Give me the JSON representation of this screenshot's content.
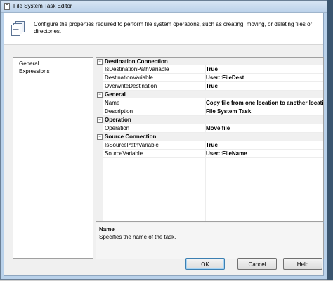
{
  "window": {
    "title": "File System Task Editor"
  },
  "header": {
    "description": "Configure the properties required to perform file system operations, such as creating, moving, or deleting files or directories."
  },
  "nav": {
    "items": [
      "General",
      "Expressions"
    ]
  },
  "grid": {
    "categories": [
      {
        "name": "Destination Connection",
        "rows": [
          {
            "key": "IsDestinationPathVariable",
            "value": "True"
          },
          {
            "key": "DestinationVariable",
            "value": "User::FileDest"
          },
          {
            "key": "OverwriteDestination",
            "value": "True"
          }
        ]
      },
      {
        "name": "General",
        "rows": [
          {
            "key": "Name",
            "value": "Copy file from one location to another location"
          },
          {
            "key": "Description",
            "value": "File System Task"
          }
        ]
      },
      {
        "name": "Operation",
        "rows": [
          {
            "key": "Operation",
            "value": "Move file"
          }
        ]
      },
      {
        "name": "Source Connection",
        "rows": [
          {
            "key": "IsSourcePathVariable",
            "value": "True"
          },
          {
            "key": "SourceVariable",
            "value": "User::FileName"
          }
        ]
      }
    ]
  },
  "description_panel": {
    "title": "Name",
    "text": "Specifies the name of the task."
  },
  "buttons": {
    "ok": "OK",
    "cancel": "Cancel",
    "help": "Help"
  }
}
